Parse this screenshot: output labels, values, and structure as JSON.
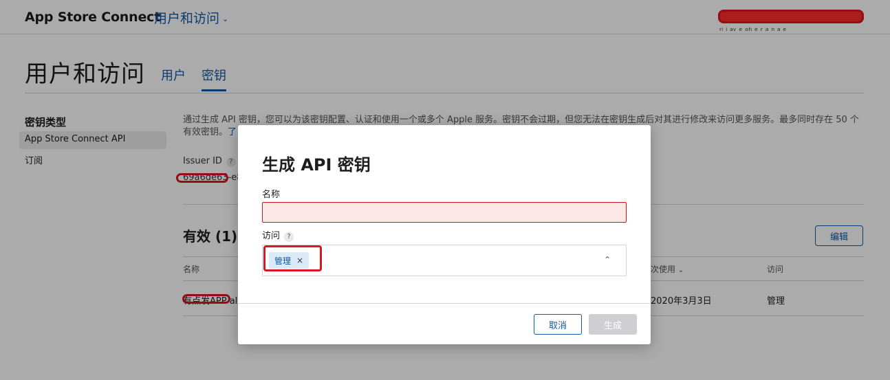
{
  "header": {
    "brand": "App Store Connect",
    "section": "用户和访问",
    "account_text": "ᵣᵢ ᵢ ₐᵥ ₑ ₒₕ ₑ ᵣ ₐ ₙ ₐ ₑ"
  },
  "page": {
    "title": "用户和访问",
    "tabs": [
      {
        "label": "用户",
        "selected": false
      },
      {
        "label": "密钥",
        "selected": true
      }
    ]
  },
  "sidebar": {
    "heading": "密钥类型",
    "items": [
      {
        "label": "App Store Connect API",
        "selected": true
      },
      {
        "label": "订阅",
        "selected": false
      }
    ]
  },
  "main": {
    "description": "通过生成 API 密钥，您可以为该密钥配置、认证和使用一个或多个 Apple 服务。密钥不会过期，但您无法在密钥生成后对其进行修改来访问更多服务。最多同时存在 50 个有效密钥。",
    "learn_more": "了",
    "issuer_label": "Issuer ID",
    "help_mark": "?",
    "issuer_value": "69a6de63-e8",
    "active_title": "有效 (1)",
    "edit_label": "编辑",
    "table": {
      "headers": [
        "名称",
        "次使用",
        "访问"
      ],
      "row": {
        "name": "有点发APP alt",
        "last_used": "2020年3月3日",
        "access": "管理"
      }
    }
  },
  "modal": {
    "title": "生成 API 密钥",
    "name_label": "名称",
    "name_value": "",
    "access_label": "访问",
    "access_help": "?",
    "selected_chip": "管理",
    "chip_remove": "×",
    "cancel_label": "取消",
    "generate_label": "生成"
  },
  "colors": {
    "accent": "#0e5aa7",
    "error_border": "#c8171c",
    "error_fill": "#fde7e7",
    "annotation_red": "#e0141e"
  }
}
